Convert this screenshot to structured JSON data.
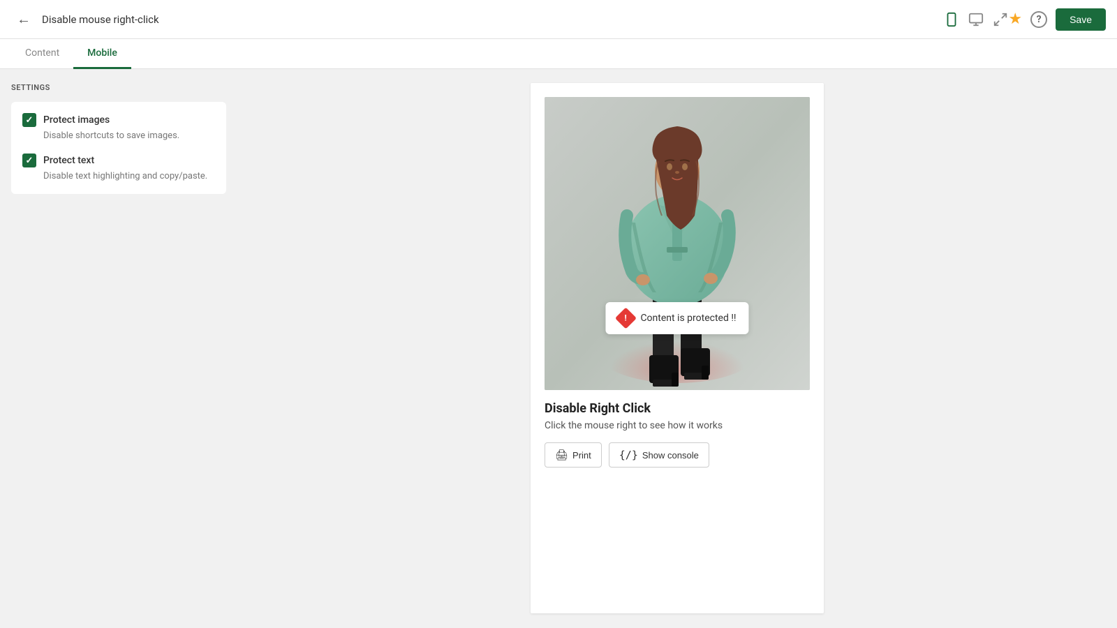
{
  "header": {
    "back_icon": "←",
    "title": "Disable mouse right-click",
    "device_icons": [
      {
        "name": "mobile",
        "symbol": "📱",
        "active": true
      },
      {
        "name": "desktop",
        "symbol": "🖥",
        "active": false
      },
      {
        "name": "expand",
        "symbol": "⇔",
        "active": false
      }
    ],
    "star_icon": "★",
    "help_icon": "?",
    "save_label": "Save"
  },
  "tabs": [
    {
      "label": "Content",
      "active": false
    },
    {
      "label": "Mobile",
      "active": true
    }
  ],
  "sidebar": {
    "section_label": "SETTINGS",
    "items": [
      {
        "id": "protect-images",
        "checked": true,
        "title": "Protect images",
        "description": "Disable shortcuts to save images."
      },
      {
        "id": "protect-text",
        "checked": true,
        "title": "Protect text",
        "description": "Disable text highlighting and copy/paste."
      }
    ]
  },
  "preview": {
    "toast_text": "Content is protected !!",
    "toast_icon": "!",
    "heading": "Disable Right Click",
    "subtext": "Click the mouse right to see how it works",
    "buttons": [
      {
        "label": "Print",
        "icon": "🖨"
      },
      {
        "label": "Show console",
        "icon": "{/}"
      }
    ]
  }
}
